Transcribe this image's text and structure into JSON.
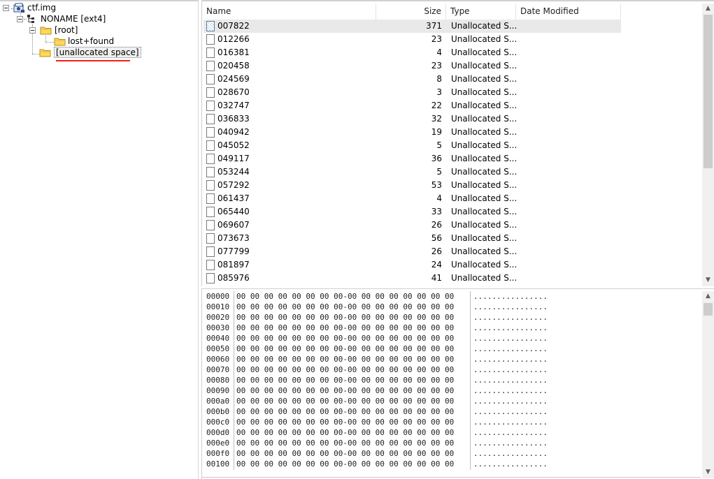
{
  "tree": {
    "root_label": "ctf.img",
    "volume_label": "NONAME [ext4]",
    "root_folder_label": "[root]",
    "lost_found_label": "lost+found",
    "unallocated_label": "[unallocated space]"
  },
  "list": {
    "columns": {
      "name": "Name",
      "size": "Size",
      "type": "Type",
      "date": "Date Modified"
    },
    "rows": [
      {
        "name": "007822",
        "size": "371",
        "type": "Unallocated S..."
      },
      {
        "name": "012266",
        "size": "23",
        "type": "Unallocated S..."
      },
      {
        "name": "016381",
        "size": "4",
        "type": "Unallocated S..."
      },
      {
        "name": "020458",
        "size": "23",
        "type": "Unallocated S..."
      },
      {
        "name": "024569",
        "size": "8",
        "type": "Unallocated S..."
      },
      {
        "name": "028670",
        "size": "3",
        "type": "Unallocated S..."
      },
      {
        "name": "032747",
        "size": "22",
        "type": "Unallocated S..."
      },
      {
        "name": "036833",
        "size": "32",
        "type": "Unallocated S..."
      },
      {
        "name": "040942",
        "size": "19",
        "type": "Unallocated S..."
      },
      {
        "name": "045052",
        "size": "5",
        "type": "Unallocated S..."
      },
      {
        "name": "049117",
        "size": "36",
        "type": "Unallocated S..."
      },
      {
        "name": "053244",
        "size": "5",
        "type": "Unallocated S..."
      },
      {
        "name": "057292",
        "size": "53",
        "type": "Unallocated S..."
      },
      {
        "name": "061437",
        "size": "4",
        "type": "Unallocated S..."
      },
      {
        "name": "065440",
        "size": "33",
        "type": "Unallocated S..."
      },
      {
        "name": "069607",
        "size": "26",
        "type": "Unallocated S..."
      },
      {
        "name": "073673",
        "size": "56",
        "type": "Unallocated S..."
      },
      {
        "name": "077799",
        "size": "26",
        "type": "Unallocated S..."
      },
      {
        "name": "081897",
        "size": "24",
        "type": "Unallocated S..."
      },
      {
        "name": "085976",
        "size": "41",
        "type": "Unallocated S..."
      }
    ]
  },
  "hex": {
    "rows": [
      {
        "off": "00000",
        "bytes": "00 00 00 00 00 00 00 00-00 00 00 00 00 00 00 00",
        "ascii": "................"
      },
      {
        "off": "00010",
        "bytes": "00 00 00 00 00 00 00 00-00 00 00 00 00 00 00 00",
        "ascii": "................"
      },
      {
        "off": "00020",
        "bytes": "00 00 00 00 00 00 00 00-00 00 00 00 00 00 00 00",
        "ascii": "................"
      },
      {
        "off": "00030",
        "bytes": "00 00 00 00 00 00 00 00-00 00 00 00 00 00 00 00",
        "ascii": "................"
      },
      {
        "off": "00040",
        "bytes": "00 00 00 00 00 00 00 00-00 00 00 00 00 00 00 00",
        "ascii": "................"
      },
      {
        "off": "00050",
        "bytes": "00 00 00 00 00 00 00 00-00 00 00 00 00 00 00 00",
        "ascii": "................"
      },
      {
        "off": "00060",
        "bytes": "00 00 00 00 00 00 00 00-00 00 00 00 00 00 00 00",
        "ascii": "................"
      },
      {
        "off": "00070",
        "bytes": "00 00 00 00 00 00 00 00-00 00 00 00 00 00 00 00",
        "ascii": "................"
      },
      {
        "off": "00080",
        "bytes": "00 00 00 00 00 00 00 00-00 00 00 00 00 00 00 00",
        "ascii": "................"
      },
      {
        "off": "00090",
        "bytes": "00 00 00 00 00 00 00 00-00 00 00 00 00 00 00 00",
        "ascii": "................"
      },
      {
        "off": "000a0",
        "bytes": "00 00 00 00 00 00 00 00-00 00 00 00 00 00 00 00",
        "ascii": "................"
      },
      {
        "off": "000b0",
        "bytes": "00 00 00 00 00 00 00 00-00 00 00 00 00 00 00 00",
        "ascii": "................"
      },
      {
        "off": "000c0",
        "bytes": "00 00 00 00 00 00 00 00-00 00 00 00 00 00 00 00",
        "ascii": "................"
      },
      {
        "off": "000d0",
        "bytes": "00 00 00 00 00 00 00 00-00 00 00 00 00 00 00 00",
        "ascii": "................"
      },
      {
        "off": "000e0",
        "bytes": "00 00 00 00 00 00 00 00-00 00 00 00 00 00 00 00",
        "ascii": "................"
      },
      {
        "off": "000f0",
        "bytes": "00 00 00 00 00 00 00 00-00 00 00 00 00 00 00 00",
        "ascii": "................"
      },
      {
        "off": "00100",
        "bytes": "00 00 00 00 00 00 00 00-00 00 00 00 00 00 00 00",
        "ascii": "................"
      }
    ]
  },
  "colors": {
    "selection_highlight": "#e9e9e9",
    "annotation_underline": "#ff1a1a",
    "scroll_thumb": "#cdcdcd"
  },
  "icons": [
    "collapse-box-icon",
    "disk-image-icon",
    "volume-tree-icon",
    "folder-icon",
    "file-icon",
    "scroll-up-arrow-icon",
    "scroll-down-arrow-icon"
  ]
}
